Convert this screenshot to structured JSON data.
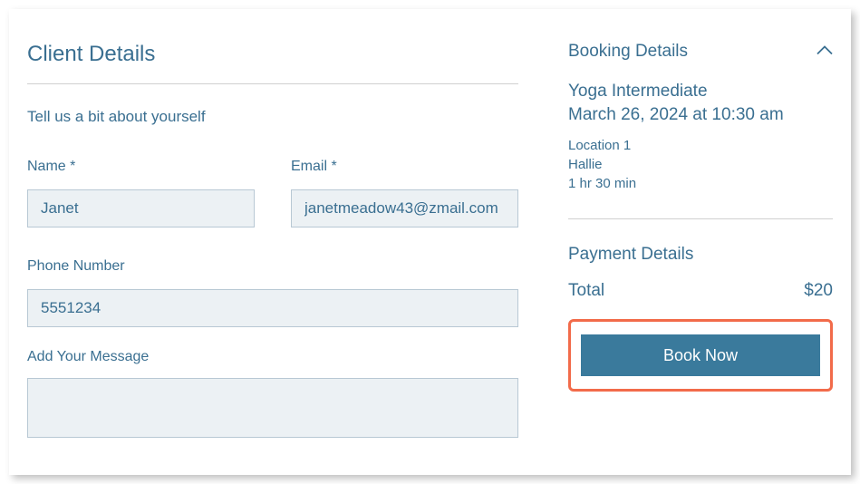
{
  "clientDetails": {
    "heading": "Client Details",
    "intro": "Tell us a bit about yourself",
    "nameLabel": "Name *",
    "nameValue": "Janet",
    "emailLabel": "Email *",
    "emailValue": "janetmeadow43@zmail.com",
    "phoneLabel": "Phone Number",
    "phoneValue": "5551234",
    "messageLabel": "Add Your Message",
    "messageValue": ""
  },
  "booking": {
    "title": "Booking Details",
    "service": "Yoga Intermediate",
    "datetime": "March 26, 2024 at 10:30 am",
    "location": "Location 1",
    "staff": "Hallie",
    "duration": "1 hr 30 min"
  },
  "payment": {
    "title": "Payment Details",
    "totalLabel": "Total",
    "totalValue": "$20"
  },
  "actions": {
    "bookNow": "Book Now"
  }
}
